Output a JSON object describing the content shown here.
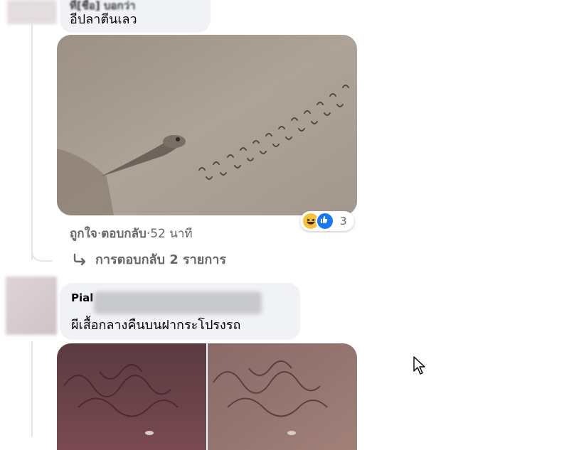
{
  "comments": [
    {
      "author_blurred": "ที่[ชื่อ] บอกว่า",
      "text": "อีปลาตีนเลว"
    },
    {
      "author": "Pial",
      "text": "ผีเสื้อกลางคืนบนฝากระโปรงรถ"
    }
  ],
  "actions": {
    "like": "ถูกใจ",
    "separator1": " · ",
    "reply": "ตอบกลับ",
    "separator2": " · ",
    "time": "52 นาที"
  },
  "reactions": {
    "count": "3",
    "icons": [
      "haha-icon",
      "like-icon"
    ],
    "colors": {
      "haha": "#f7c33b",
      "like": "#1877f2"
    }
  },
  "replies": {
    "arrow_icon": "reply-arrow-icon",
    "label": "การตอบกลับ 2 รายการ"
  },
  "colors": {
    "bubble": "#f0f2f5",
    "secondary_text": "#65676b",
    "thread_line": "#e4e6eb"
  }
}
